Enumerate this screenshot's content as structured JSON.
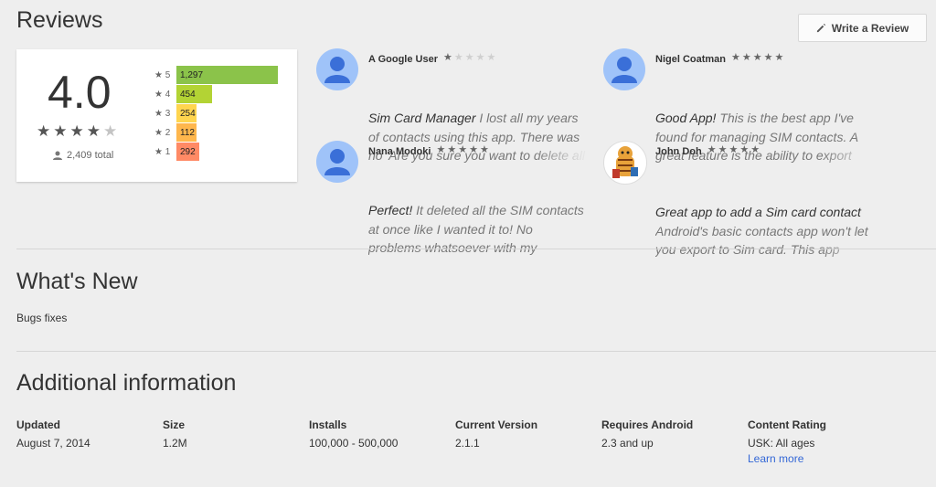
{
  "reviews_section": {
    "title": "Reviews",
    "write_review_label": "Write a Review",
    "summary": {
      "score": "4.0",
      "star_rating": 4,
      "total_label": "2,409 total",
      "histogram": [
        {
          "stars": "5",
          "count_label": "1,297",
          "count": 1297,
          "color": "#8bc34a"
        },
        {
          "stars": "4",
          "count_label": "454",
          "count": 454,
          "color": "#b3d334"
        },
        {
          "stars": "3",
          "count_label": "254",
          "count": 254,
          "color": "#ffd54f"
        },
        {
          "stars": "2",
          "count_label": "112",
          "count": 112,
          "color": "#ffb74d"
        },
        {
          "stars": "1",
          "count_label": "292",
          "count": 292,
          "color": "#ff8a65"
        }
      ]
    },
    "reviews": [
      {
        "author": "A Google User",
        "rating": 1,
        "title": "Sim Card Manager",
        "body": "I lost all my years of contacts using this app. There was no 'Are you sure you want to delete all"
      },
      {
        "author": "Nigel Coatman",
        "rating": 5,
        "title": "Good App!",
        "body": "This is the best app I've found for managing SIM contacts. A great feature is the ability to export"
      },
      {
        "author": "Nana Modoki",
        "rating": 5,
        "title": "Perfect!",
        "body": "It deleted all the SIM contacts at once like I wanted it to! No problems whatsoever with my"
      },
      {
        "author": "John Doh",
        "rating": 5,
        "title": "Great app to add a Sim card contact",
        "body": "Android's basic contacts app won't let you export to Sim card. This app"
      }
    ]
  },
  "whats_new": {
    "title": "What's New",
    "text": "Bugs fixes"
  },
  "additional_info": {
    "title": "Additional information",
    "items": [
      {
        "label": "Updated",
        "value": "August 7, 2014"
      },
      {
        "label": "Size",
        "value": "1.2M"
      },
      {
        "label": "Installs",
        "value": "100,000 - 500,000"
      },
      {
        "label": "Current Version",
        "value": "2.1.1"
      },
      {
        "label": "Requires Android",
        "value": "2.3 and up"
      },
      {
        "label": "Content Rating",
        "value": "USK: All ages",
        "link": "Learn more"
      }
    ]
  }
}
